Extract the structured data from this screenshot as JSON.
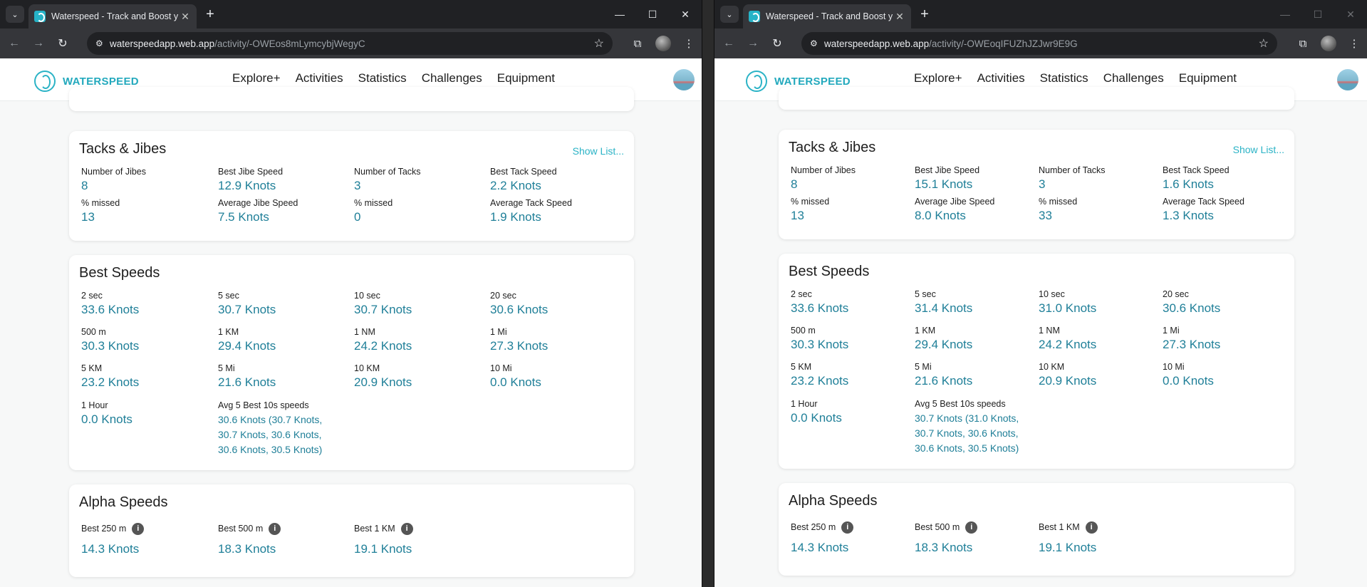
{
  "left": {
    "tab": {
      "title": "Waterspeed - Track and Boost y",
      "close": "✕"
    },
    "url": {
      "host": "waterspeedapp.web.app",
      "path": "/activity/-OWEos8mLymcybjWegyC"
    },
    "app": {
      "brand": "WATERSPEED",
      "nav": [
        "Explore+",
        "Activities",
        "Statistics",
        "Challenges",
        "Equipment"
      ]
    },
    "tacks": {
      "title": "Tacks & Jibes",
      "show_list": "Show List...",
      "stats": [
        {
          "label": "Number of Jibes",
          "value": "8"
        },
        {
          "label": "Best Jibe Speed",
          "value": "12.9 Knots"
        },
        {
          "label": "Number of Tacks",
          "value": "3"
        },
        {
          "label": "Best Tack Speed",
          "value": "2.2 Knots"
        },
        {
          "label": "% missed",
          "value": "13"
        },
        {
          "label": "Average Jibe Speed",
          "value": "7.5 Knots"
        },
        {
          "label": "% missed",
          "value": "0"
        },
        {
          "label": "Average Tack Speed",
          "value": "1.9 Knots"
        }
      ]
    },
    "best": {
      "title": "Best Speeds",
      "stats": [
        {
          "label": "2 sec",
          "value": "33.6 Knots"
        },
        {
          "label": "5 sec",
          "value": "30.7 Knots"
        },
        {
          "label": "10 sec",
          "value": "30.7 Knots"
        },
        {
          "label": "20 sec",
          "value": "30.6 Knots"
        },
        {
          "label": "500 m",
          "value": "30.3 Knots"
        },
        {
          "label": "1 KM",
          "value": "29.4 Knots"
        },
        {
          "label": "1 NM",
          "value": "24.2 Knots"
        },
        {
          "label": "1 Mi",
          "value": "27.3 Knots"
        },
        {
          "label": "5 KM",
          "value": "23.2 Knots"
        },
        {
          "label": "5 Mi",
          "value": "21.6 Knots"
        },
        {
          "label": "10 KM",
          "value": "20.9 Knots"
        },
        {
          "label": "10 Mi",
          "value": "0.0 Knots"
        },
        {
          "label": "1 Hour",
          "value": "0.0 Knots"
        },
        {
          "label": "Avg 5 Best 10s speeds",
          "value": "30.6 Knots (30.7 Knots, 30.7 Knots, 30.6 Knots, 30.6 Knots, 30.5 Knots)"
        }
      ]
    },
    "alpha": {
      "title": "Alpha Speeds",
      "stats": [
        {
          "label": "Best 250 m",
          "value": "14.3 Knots"
        },
        {
          "label": "Best 500 m",
          "value": "18.3 Knots"
        },
        {
          "label": "Best 1 KM",
          "value": "19.1 Knots"
        }
      ]
    }
  },
  "right": {
    "tab": {
      "title": "Waterspeed - Track and Boost y",
      "close": "✕"
    },
    "url": {
      "host": "waterspeedapp.web.app",
      "path": "/activity/-OWEoqIFUZhJZJwr9E9G"
    },
    "app": {
      "brand": "WATERSPEED",
      "nav": [
        "Explore+",
        "Activities",
        "Statistics",
        "Challenges",
        "Equipment"
      ]
    },
    "tacks": {
      "title": "Tacks & Jibes",
      "show_list": "Show List...",
      "stats": [
        {
          "label": "Number of Jibes",
          "value": "8"
        },
        {
          "label": "Best Jibe Speed",
          "value": "15.1 Knots"
        },
        {
          "label": "Number of Tacks",
          "value": "3"
        },
        {
          "label": "Best Tack Speed",
          "value": "1.6 Knots"
        },
        {
          "label": "% missed",
          "value": "13"
        },
        {
          "label": "Average Jibe Speed",
          "value": "8.0 Knots"
        },
        {
          "label": "% missed",
          "value": "33"
        },
        {
          "label": "Average Tack Speed",
          "value": "1.3 Knots"
        }
      ]
    },
    "best": {
      "title": "Best Speeds",
      "stats": [
        {
          "label": "2 sec",
          "value": "33.6 Knots"
        },
        {
          "label": "5 sec",
          "value": "31.4 Knots"
        },
        {
          "label": "10 sec",
          "value": "31.0 Knots"
        },
        {
          "label": "20 sec",
          "value": "30.6 Knots"
        },
        {
          "label": "500 m",
          "value": "30.3 Knots"
        },
        {
          "label": "1 KM",
          "value": "29.4 Knots"
        },
        {
          "label": "1 NM",
          "value": "24.2 Knots"
        },
        {
          "label": "1 Mi",
          "value": "27.3 Knots"
        },
        {
          "label": "5 KM",
          "value": "23.2 Knots"
        },
        {
          "label": "5 Mi",
          "value": "21.6 Knots"
        },
        {
          "label": "10 KM",
          "value": "20.9 Knots"
        },
        {
          "label": "10 Mi",
          "value": "0.0 Knots"
        },
        {
          "label": "1 Hour",
          "value": "0.0 Knots"
        },
        {
          "label": "Avg 5 Best 10s speeds",
          "value": "30.7 Knots (31.0 Knots, 30.7 Knots, 30.6 Knots, 30.6 Knots, 30.5 Knots)"
        }
      ]
    },
    "alpha": {
      "title": "Alpha Speeds",
      "stats": [
        {
          "label": "Best 250 m",
          "value": "14.3 Knots"
        },
        {
          "label": "Best 500 m",
          "value": "18.3 Knots"
        },
        {
          "label": "Best 1 KM",
          "value": "19.1 Knots"
        }
      ]
    }
  },
  "icons": {
    "tab_dropdown": "chevron-down-icon",
    "new_tab": "plus-icon",
    "back": "arrow-left-icon",
    "forward": "arrow-right-icon",
    "reload": "reload-icon",
    "site_info": "tune-icon",
    "bookmark": "star-icon",
    "extensions": "puzzle-icon",
    "menu": "kebab-menu-icon",
    "info": "info-icon"
  },
  "colors": {
    "accent": "#2bb3c6",
    "value_text": "#1f7f98",
    "page_bg": "#f7f8f8"
  }
}
